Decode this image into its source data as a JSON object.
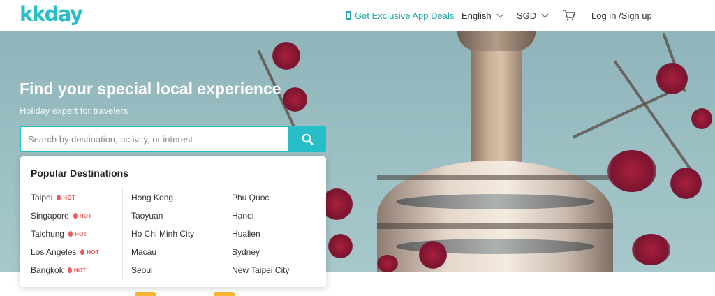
{
  "header": {
    "logo": "kkday",
    "app_deals": "Get Exclusive App Deals",
    "language": "English",
    "currency": "SGD",
    "login": "Log in /Sign up"
  },
  "hero": {
    "title": "Find your special local experience",
    "subtitle": "Holiday expert for travelers"
  },
  "search": {
    "placeholder": "Search by destination, activity, or interest",
    "value": ""
  },
  "popular": {
    "title": "Popular Destinations",
    "hot_label": "HOT",
    "col1": [
      "Taipei",
      "Singapore",
      "Taichung",
      "Los Angeles",
      "Bangkok"
    ],
    "col2": [
      "Hong Kong",
      "Taoyuan",
      "Ho Chi Minh City",
      "Macau",
      "Seoul"
    ],
    "col3": [
      "Phu Quoc",
      "Hanoi",
      "Hualien",
      "Sydney",
      "New Taipei City"
    ]
  },
  "colors": {
    "brand": "#26bec9",
    "hot": "#ef5b5b"
  },
  "icons": [
    "phone-icon",
    "chevron-down-icon",
    "cart-icon",
    "search-icon",
    "flame-icon"
  ]
}
